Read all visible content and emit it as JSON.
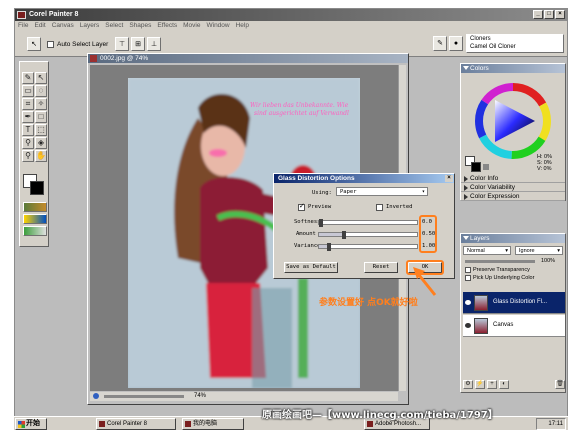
{
  "app": {
    "title": "Corel Painter 8",
    "menu": [
      "File",
      "Edit",
      "Canvas",
      "Layers",
      "Select",
      "Shapes",
      "Effects",
      "Movie",
      "Window",
      "Help"
    ]
  },
  "property_bar": {
    "auto_select_layer": "Auto Select Layer",
    "brush_category": "Cloners",
    "brush_variant": "Camel Oil Cloner"
  },
  "document": {
    "title": "0002.jpg @ 74%",
    "zoom": "74%",
    "photo_caption_line1": "Wir lieben das Unbekannte. Wie",
    "photo_caption_line2": "sind ausgerichtet auf Verwandl"
  },
  "dialog": {
    "title": "Glass Distortion Options",
    "using_label": "Using:",
    "using_value": "Paper",
    "preview_label": "Preview",
    "inverted_label": "Inverted",
    "softness_label": "Softness",
    "softness_value": "0.0",
    "amount_label": "Amount",
    "amount_value": "0.50",
    "variance_label": "Variance",
    "variance_value": "1.00",
    "save_default": "Save as Default",
    "reset": "Reset",
    "ok": "OK",
    "sliders": {
      "softness": 0.0,
      "amount": 0.25,
      "variance": 0.1
    }
  },
  "panels": {
    "colors": "Colors",
    "color_info": "Color Info",
    "color_variability": "Color Variability",
    "color_expression": "Color Expression",
    "color_readout": [
      "H: 0%",
      "S: 0%",
      "V: 0%"
    ],
    "layers": "Layers",
    "composite_method": "Normal",
    "composite_depth": "Ignore",
    "opacity": "100%",
    "preserve_transparency": "Preserve Transparency",
    "pick_up_underlying": "Pick Up Underlying Color",
    "layer_items": [
      "Glass Distortion Fl...",
      "Canvas"
    ]
  },
  "annotation": {
    "text": "参数设置好 点OK就好啦"
  },
  "watermark": "原画绘画吧—【www.linecg.com/tieba/1797】",
  "taskbar": {
    "start": "开始",
    "items": [
      "Corel Painter 8",
      "我的电脑",
      "Adobe Photosh..."
    ],
    "clock": "17:11"
  },
  "colors": {
    "accent_orange": "#ff7f1e",
    "caption_pink": "#ff5fbf"
  }
}
